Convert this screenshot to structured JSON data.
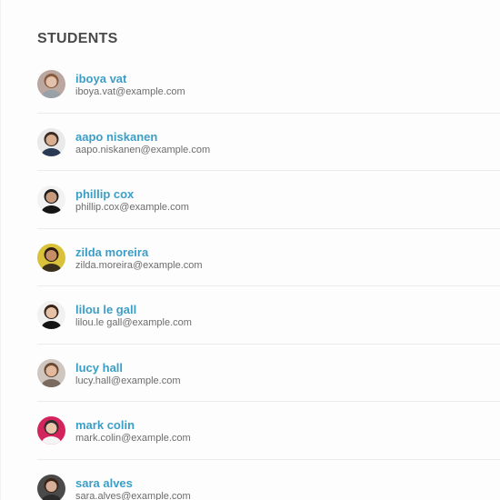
{
  "section": {
    "title": "STUDENTS"
  },
  "students": [
    {
      "name": "iboya vat",
      "email": "iboya.vat@example.com",
      "avatar_bg": "#b9a7a0",
      "avatar_skin": "#e3c2ad",
      "avatar_hair": "#8a5a3c",
      "avatar_shirt": "#9aa0a8"
    },
    {
      "name": "aapo niskanen",
      "email": "aapo.niskanen@example.com",
      "avatar_bg": "#e9e9e9",
      "avatar_skin": "#d9ad8f",
      "avatar_hair": "#3b2b22",
      "avatar_shirt": "#2a3a55"
    },
    {
      "name": "phillip cox",
      "email": "phillip.cox@example.com",
      "avatar_bg": "#f2f2f2",
      "avatar_skin": "#c79a7c",
      "avatar_hair": "#1d1d1d",
      "avatar_shirt": "#151515"
    },
    {
      "name": "zilda moreira",
      "email": "zilda.moreira@example.com",
      "avatar_bg": "#d9c23a",
      "avatar_skin": "#c58e66",
      "avatar_hair": "#2a1b12",
      "avatar_shirt": "#3a2f1c"
    },
    {
      "name": "lilou le gall",
      "email": "lilou.le gall@example.com",
      "avatar_bg": "#f1f1f1",
      "avatar_skin": "#e7c1a6",
      "avatar_hair": "#3a2418",
      "avatar_shirt": "#141414"
    },
    {
      "name": "lucy hall",
      "email": "lucy.hall@example.com",
      "avatar_bg": "#cfc6bf",
      "avatar_skin": "#e2b99c",
      "avatar_hair": "#6b4a34",
      "avatar_shirt": "#7a6a60"
    },
    {
      "name": "mark colin",
      "email": "mark.colin@example.com",
      "avatar_bg": "#d4245c",
      "avatar_skin": "#ecc6ab",
      "avatar_hair": "#2e2e2e",
      "avatar_shirt": "#f4f4f4"
    },
    {
      "name": "sara alves",
      "email": "sara.alves@example.com",
      "avatar_bg": "#4a4a4a",
      "avatar_skin": "#d8b09a",
      "avatar_hair": "#3d2416",
      "avatar_shirt": "#2b2b2b"
    }
  ]
}
